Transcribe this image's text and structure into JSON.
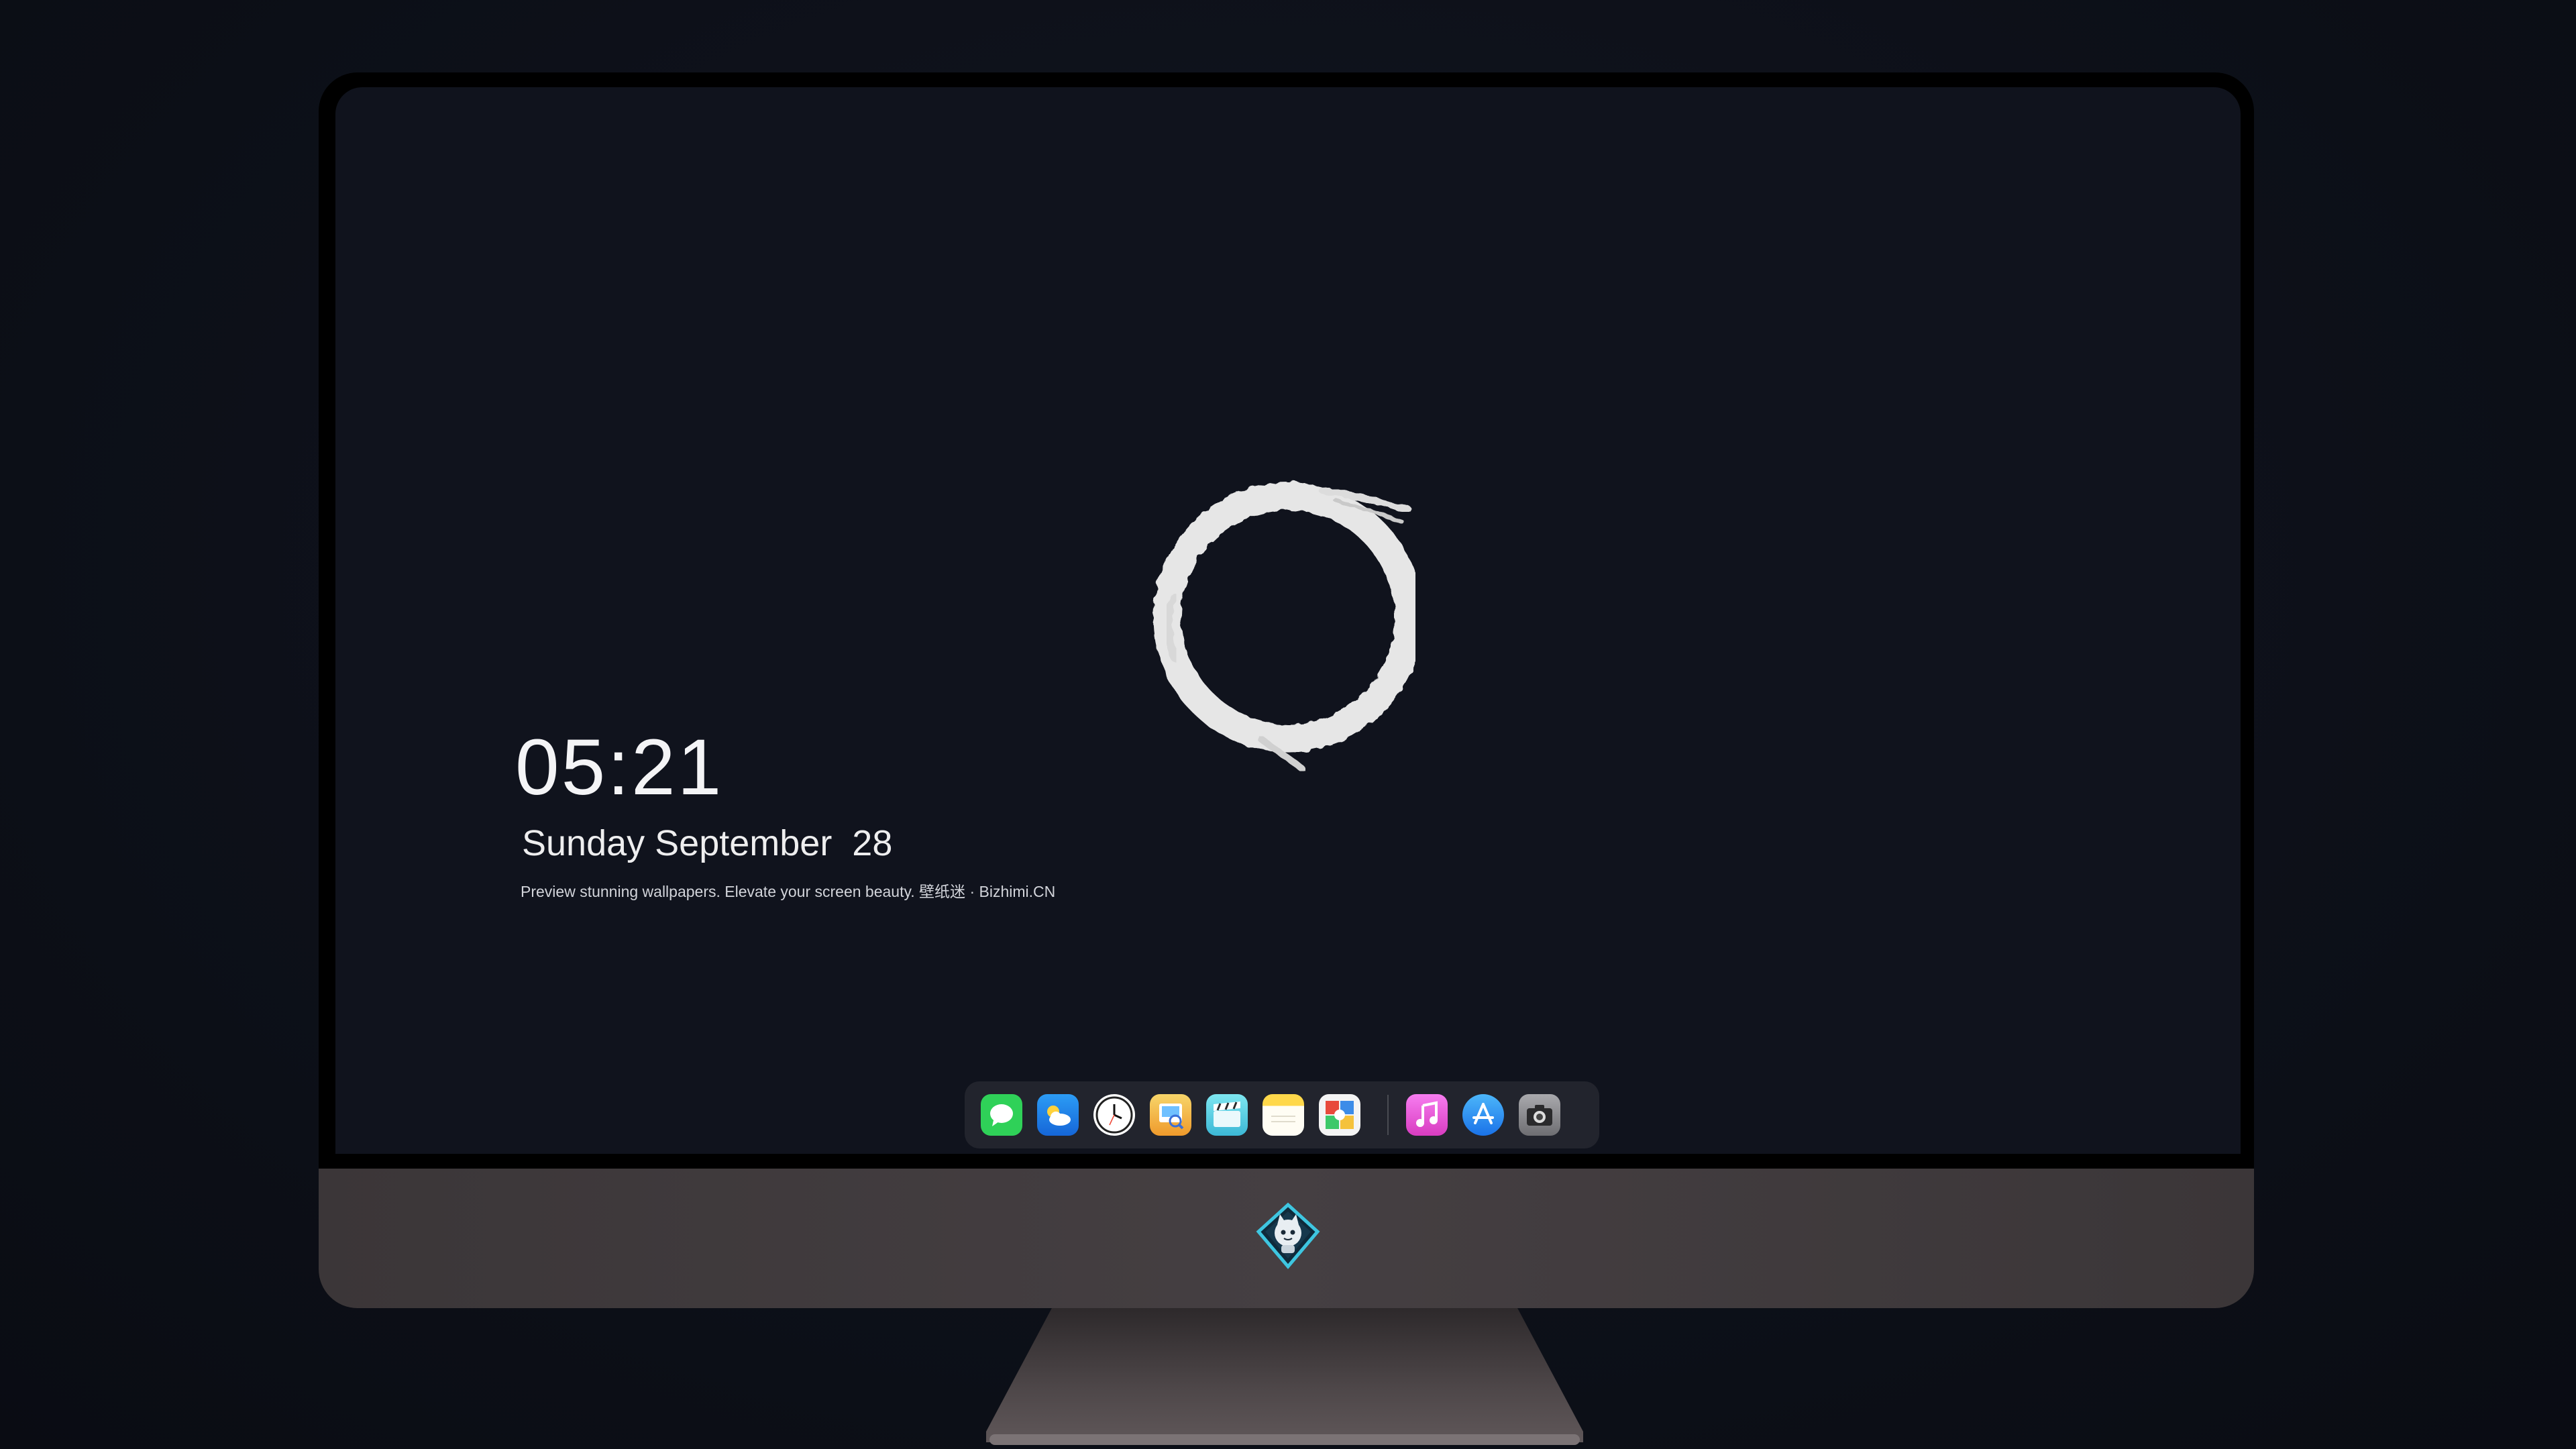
{
  "lockscreen": {
    "time": "05:21",
    "date": "Sunday September  28",
    "tagline": "Preview stunning wallpapers. Elevate your screen beauty. 壁纸迷 · Bizhimi.CN"
  },
  "dock": {
    "apps": [
      {
        "name": "messages-icon",
        "color": "#2fd158"
      },
      {
        "name": "weather-icon",
        "color": "#1e88f0"
      },
      {
        "name": "clock-icon",
        "color": "#ffffff"
      },
      {
        "name": "preview-icon",
        "color": "#f5c24a"
      },
      {
        "name": "final-cut-icon",
        "color": "#5cd6e8"
      },
      {
        "name": "notes-icon",
        "color": "#ffd84a"
      },
      {
        "name": "photo-booth-icon",
        "color": "#e84a3c"
      },
      {
        "name": "music-icon",
        "color": "#f04fc8"
      },
      {
        "name": "app-store-icon",
        "color": "#1e8ef6"
      },
      {
        "name": "camera-icon",
        "color": "#8a8a8e"
      }
    ]
  },
  "colors": {
    "screen_background": "#10131d",
    "bezel": "#000000",
    "chin": "#433d40",
    "text": "#f4f4f6"
  }
}
